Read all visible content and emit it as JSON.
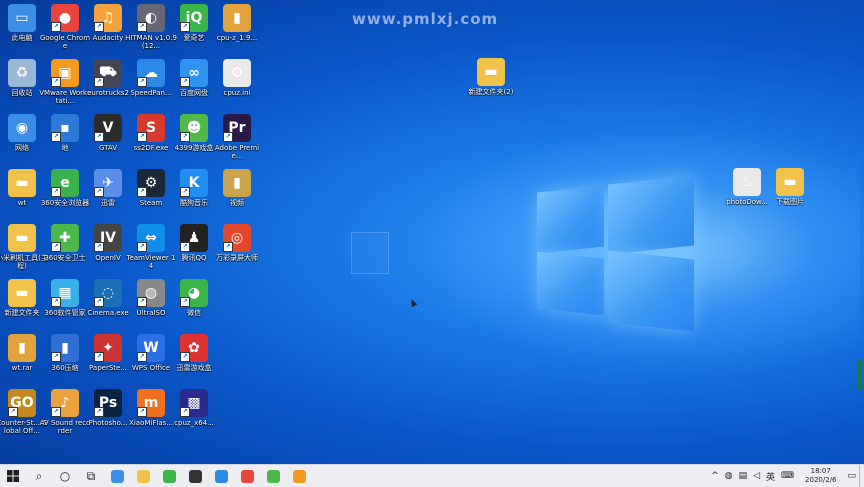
{
  "watermark": "www.pmlxj.com",
  "desktop_icons": [
    {
      "label": "此电脑",
      "color": "#3b8ee8",
      "glyph": "▭",
      "icon": "computer-icon",
      "shortcut": false
    },
    {
      "label": "Google Chrome",
      "color": "#e8453c",
      "glyph": "●",
      "icon": "chrome-icon",
      "shortcut": true
    },
    {
      "label": "Audacity",
      "color": "#f3a33a",
      "glyph": "♫",
      "icon": "audacity-icon",
      "shortcut": true
    },
    {
      "label": "HITMAN v1.0.9 (12...",
      "color": "#667",
      "glyph": "◐",
      "icon": "hitman-icon",
      "shortcut": true
    },
    {
      "label": "爱奇艺",
      "color": "#3bb54a",
      "glyph": "iQ",
      "icon": "iqiyi-icon",
      "shortcut": true
    },
    {
      "label": "cpu-z_1.9...",
      "color": "#e2a33c",
      "glyph": "▮",
      "icon": "winrar-icon",
      "shortcut": false
    },
    {
      "label": "回收站",
      "color": "#9ab7d8",
      "glyph": "♻",
      "icon": "recycle-bin-icon",
      "shortcut": false
    },
    {
      "label": "VMware Workstati...",
      "color": "#f39a1e",
      "glyph": "▣",
      "icon": "vmware-icon",
      "shortcut": true
    },
    {
      "label": "eurotrucks2",
      "color": "#445",
      "glyph": "⛟",
      "icon": "truck-icon",
      "shortcut": true
    },
    {
      "label": "SpeedPan...",
      "color": "#2a8ae6",
      "glyph": "☁",
      "icon": "cloud-icon",
      "shortcut": true
    },
    {
      "label": "百度网盘",
      "color": "#2f93f0",
      "glyph": "∞",
      "icon": "baidu-netdisk-icon",
      "shortcut": true
    },
    {
      "label": "cpuz.ini",
      "color": "#e8e8e8",
      "glyph": "⚙",
      "icon": "settings-file-icon",
      "shortcut": false
    },
    {
      "label": "网络",
      "color": "#3b8ee8",
      "glyph": "◉",
      "icon": "network-icon",
      "shortcut": false
    },
    {
      "label": "地",
      "color": "#2d7ad8",
      "glyph": "▪",
      "icon": "app-icon",
      "shortcut": true
    },
    {
      "label": "GTAV",
      "color": "#2b2b2b",
      "glyph": "V",
      "icon": "gtav-icon",
      "shortcut": true
    },
    {
      "label": "ss2DF.exe",
      "color": "#d93a2c",
      "glyph": "S",
      "icon": "ss-icon",
      "shortcut": true
    },
    {
      "label": "4399游戏盒",
      "color": "#53b848",
      "glyph": "☻",
      "icon": "game-box-icon",
      "shortcut": true
    },
    {
      "label": "Adobe Premie...",
      "color": "#2a1848",
      "glyph": "Pr",
      "icon": "premiere-icon",
      "shortcut": true
    },
    {
      "label": "wt",
      "color": "#f1c24a",
      "glyph": "▬",
      "icon": "folder-icon",
      "shortcut": false
    },
    {
      "label": "360安全浏览器",
      "color": "#3ab14a",
      "glyph": "e",
      "icon": "browser-360-icon",
      "shortcut": true
    },
    {
      "label": "迅雷",
      "color": "#5a8ee8",
      "glyph": "✈",
      "icon": "xunlei-icon",
      "shortcut": true
    },
    {
      "label": "Steam",
      "color": "#1b2838",
      "glyph": "⚙",
      "icon": "steam-icon",
      "shortcut": true
    },
    {
      "label": "酷狗音乐",
      "color": "#1f8ef2",
      "glyph": "K",
      "icon": "kugou-icon",
      "shortcut": true
    },
    {
      "label": "视频",
      "color": "#c9a44a",
      "glyph": "▮",
      "icon": "winrar-icon",
      "shortcut": false
    },
    {
      "label": "小米刷机工具(主程)",
      "color": "#f1c24a",
      "glyph": "▬",
      "icon": "folder-icon",
      "shortcut": false
    },
    {
      "label": "360安全卫士",
      "color": "#4cb84a",
      "glyph": "✚",
      "icon": "security-360-icon",
      "shortcut": true
    },
    {
      "label": "OpenIV",
      "color": "#444",
      "glyph": "IV",
      "icon": "openiv-icon",
      "shortcut": true
    },
    {
      "label": "TeamViewer 14",
      "color": "#0e8ee9",
      "glyph": "⇔",
      "icon": "teamviewer-icon",
      "shortcut": true
    },
    {
      "label": "腾讯QQ",
      "color": "#222",
      "glyph": "♟",
      "icon": "qq-icon",
      "shortcut": true
    },
    {
      "label": "万彩录屏大师",
      "color": "#e2462c",
      "glyph": "◎",
      "icon": "recorder-icon",
      "shortcut": true
    },
    {
      "label": "新建文件夹",
      "color": "#f1c24a",
      "glyph": "▬",
      "icon": "folder-icon",
      "shortcut": false
    },
    {
      "label": "360软件管家",
      "color": "#3ab0e8",
      "glyph": "▦",
      "icon": "software-manager-icon",
      "shortcut": true
    },
    {
      "label": "Cinema.exe",
      "color": "#1b6fb5",
      "glyph": "◌",
      "icon": "cinema-icon",
      "shortcut": true
    },
    {
      "label": "UltraISO",
      "color": "#888",
      "glyph": "◍",
      "icon": "ultraiso-icon",
      "shortcut": true
    },
    {
      "label": "微信",
      "color": "#3bb54a",
      "glyph": "◕",
      "icon": "wechat-icon",
      "shortcut": true
    },
    null,
    {
      "label": "wt.rar",
      "color": "#e2a33c",
      "glyph": "▮",
      "icon": "winrar-icon",
      "shortcut": false
    },
    {
      "label": "360压缩",
      "color": "#2f6fd6",
      "glyph": "▮",
      "icon": "archive-360-icon",
      "shortcut": true
    },
    {
      "label": "PaperSte...",
      "color": "#c33",
      "glyph": "✦",
      "icon": "paper-icon",
      "shortcut": true
    },
    {
      "label": "WPS Office",
      "color": "#2a6fe6",
      "glyph": "W",
      "icon": "wps-icon",
      "shortcut": true
    },
    {
      "label": "迅雷游戏盒",
      "color": "#d33",
      "glyph": "✿",
      "icon": "game-center-icon",
      "shortcut": true
    },
    null,
    {
      "label": "Counter-St... Global Off...",
      "color": "#c28a1e",
      "glyph": "GO",
      "icon": "csgo-icon",
      "shortcut": true
    },
    {
      "label": "AV Sound recorder",
      "color": "#e8a33c",
      "glyph": "♪",
      "icon": "sound-recorder-icon",
      "shortcut": true
    },
    {
      "label": "Photosho...",
      "color": "#0c2340",
      "glyph": "Ps",
      "icon": "photoshop-icon",
      "shortcut": true
    },
    {
      "label": "XiaoMiFlas...",
      "color": "#f07020",
      "glyph": "m",
      "icon": "xiaomi-icon",
      "shortcut": true
    },
    {
      "label": "cpuz_x64...",
      "color": "#2a2a8a",
      "glyph": "▩",
      "icon": "cpuz-icon",
      "shortcut": true
    },
    null
  ],
  "floating_icons": [
    {
      "label": "新建文件夹(2)",
      "color": "#f1c24a",
      "glyph": "▬",
      "icon": "folder-icon"
    },
    {
      "label": "photoDow...",
      "color": "#e8e8e8",
      "glyph": "♨",
      "icon": "java-icon"
    },
    {
      "label": "下载图片",
      "color": "#f1c24a",
      "glyph": "▬",
      "icon": "folder-icon"
    }
  ],
  "taskbar": {
    "start_icon": "windows-start-icon",
    "tray_lang": "英",
    "tray_up": "^",
    "time": "18:07",
    "date": "2020/2/6"
  },
  "taskbar_apps": [
    "#3b8ee8",
    "#f1c24a",
    "#3bb54a",
    "#333",
    "#2a8ae6",
    "#e8453c",
    "#4cb84a",
    "#f39a1e"
  ]
}
